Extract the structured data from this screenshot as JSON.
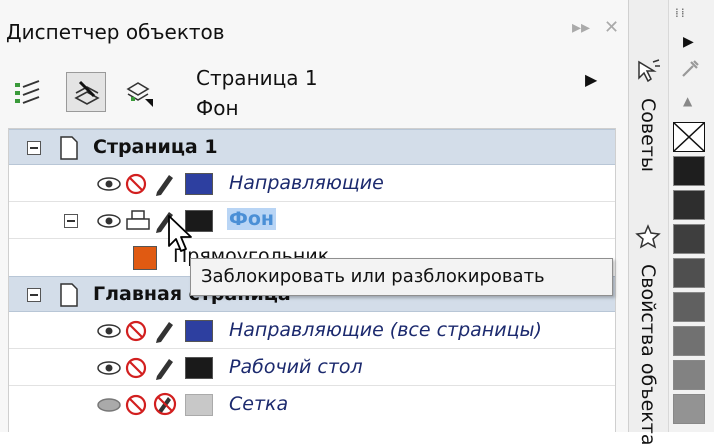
{
  "panel": {
    "title": "Диспетчер объектов",
    "controls": {
      "collapse_icon": "double-chevron-right-icon",
      "close_icon": "close-icon"
    }
  },
  "toolbar": {
    "buttons": [
      {
        "icon": "show-object-properties-icon",
        "active": false
      },
      {
        "icon": "edit-across-layers-icon",
        "active": true
      },
      {
        "icon": "layer-manager-view-icon",
        "active": false
      }
    ],
    "current_page": "Страница 1",
    "current_layer": "Фон",
    "menu_icon": "flyout-arrow-icon"
  },
  "tree": {
    "page1": {
      "name": "Страница 1",
      "layers": [
        {
          "name": "Направляющие",
          "swatch": "#2d3fa0"
        },
        {
          "name": "Фон",
          "swatch": "#1a1a1a",
          "selected": true
        }
      ],
      "object": {
        "name": "Прямоугольник",
        "swatch": "#e05a12"
      }
    },
    "master": {
      "name": "Главная страница",
      "layers": [
        {
          "name": "Направляющие (все страницы)",
          "swatch": "#2d3fa0"
        },
        {
          "name": "Рабочий стол",
          "swatch": "#1a1a1a"
        },
        {
          "name": "Сетка",
          "swatch": "#c8c8c8"
        }
      ]
    }
  },
  "tooltip": {
    "text": "Заблокировать или разблокировать"
  },
  "side_tabs": [
    {
      "label": "Советы",
      "icon": "hints-icon"
    },
    {
      "label": "Свойства объекта",
      "icon": "object-properties-icon"
    }
  ],
  "palette": {
    "swatches": [
      "none",
      "#1e1e1e",
      "#2e2e2e",
      "#3e3e3e",
      "#4f4f4f",
      "#606060",
      "#717171",
      "#828282",
      "#939393",
      "#a4a4a4"
    ]
  }
}
